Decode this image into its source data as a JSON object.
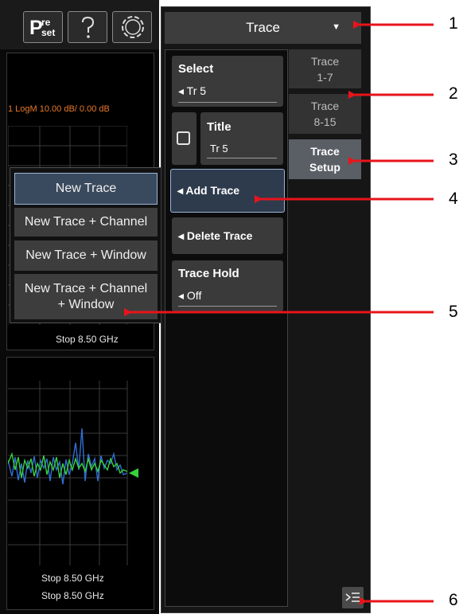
{
  "toolbar": {
    "preset_top": "re",
    "preset_bottom": "set",
    "preset_letter": "P",
    "help_icon": "question-icon",
    "settings_icon": "circle-gear-icon"
  },
  "window1": {
    "trace_annotation": "1  LogM  10.00 dB/  0.00 dB",
    "stop": "Stop  8.50 GHz"
  },
  "window2": {
    "stop1": "Stop  8.50 GHz",
    "stop2": "Stop  8.50 GHz"
  },
  "popup": {
    "items": [
      "New Trace",
      "New Trace + Channel",
      "New Trace + Window",
      "New Trace + Channel",
      "+ Window"
    ]
  },
  "menu": {
    "title": "Trace",
    "title_arrow": "▼"
  },
  "softkeys": {
    "select_label": "Select",
    "select_value": "◂  Tr 5",
    "title_label": "Title",
    "title_value": "Tr 5",
    "add_trace": "◂  Add Trace",
    "delete_trace": "◂  Delete Trace",
    "trace_hold_label": "Trace Hold",
    "trace_hold_value": "◂  Off"
  },
  "tabs": [
    {
      "line1": "Trace",
      "line2": "1-7"
    },
    {
      "line1": "Trace",
      "line2": "8-15"
    },
    {
      "line1": "Trace",
      "line2": "Setup"
    }
  ],
  "callouts": [
    "1",
    "2",
    "3",
    "4",
    "5",
    "6"
  ],
  "colors": {
    "accent_arrow": "#e8141b",
    "trace_green": "#38d23a",
    "trace_blue": "#2f6fd4",
    "annotation_orange": "#e8792a",
    "selected_border": "#9bb4d6"
  }
}
